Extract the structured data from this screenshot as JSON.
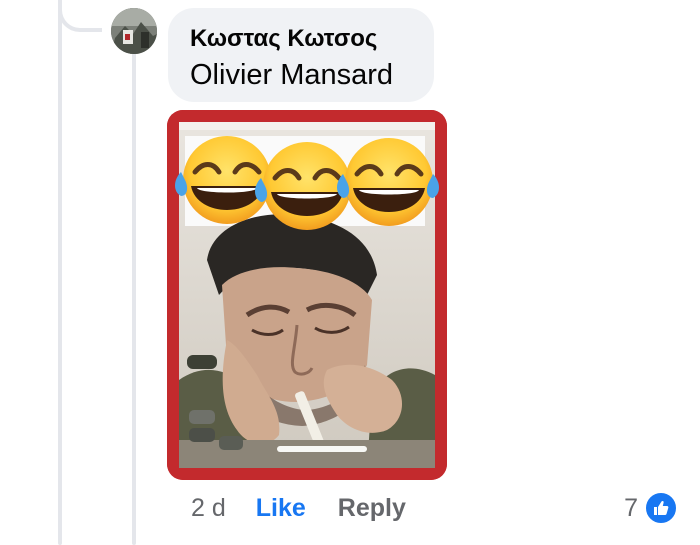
{
  "comment": {
    "author": "Κωστας Κωτσος",
    "text": "Olivier Mansard",
    "time": "2 d",
    "like_label": "Like",
    "reply_label": "Reply",
    "reaction_count": "7"
  },
  "attachment": {
    "emojis": [
      "laughing-crying-emoji",
      "laughing-crying-emoji",
      "laughing-crying-emoji"
    ]
  },
  "colors": {
    "bubble_bg": "#f0f2f5",
    "link_blue": "#1877f2",
    "muted_text": "#65676b",
    "image_border_red": "#c32a2d"
  },
  "icons": {
    "reaction": "thumbs-up-icon"
  }
}
